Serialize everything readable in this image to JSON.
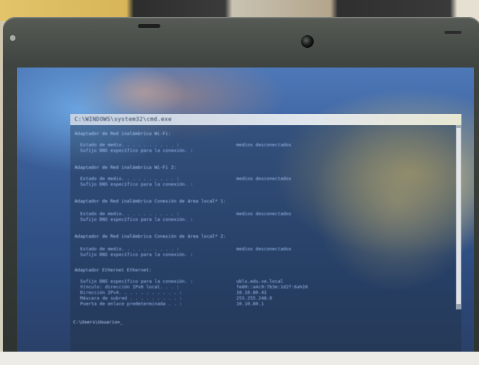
{
  "terminal": {
    "title": "C:\\WINDOWS\\system32\\cmd.exe"
  },
  "output": {
    "sections": [
      {
        "header": "Adaptador de Red inalámbrica Wi-Fi:",
        "lines": [
          {
            "label": "Estado de medio. . . . . . . . . . :",
            "value": "medios desconectados"
          },
          {
            "label": "Sufijo DNS específico para la conexión. :",
            "value": ""
          }
        ]
      },
      {
        "header": "Adaptador de Red inalámbrica Wi-Fi 2:",
        "lines": [
          {
            "label": "Estado de medio. . . . . . . . . . :",
            "value": "medios desconectados"
          },
          {
            "label": "Sufijo DNS específico para la conexión. :",
            "value": ""
          }
        ]
      },
      {
        "header": "Adaptador de Red inalámbrica Conexión de área local* 1:",
        "lines": [
          {
            "label": "Estado de medio. . . . . . . . . . :",
            "value": "medios desconectados"
          },
          {
            "label": "Sufijo DNS específico para la conexión. :",
            "value": ""
          }
        ]
      },
      {
        "header": "Adaptador de Red inalámbrica Conexión de área local* 2:",
        "lines": [
          {
            "label": "Estado de medio. . . . . . . . . . :",
            "value": "medios desconectados"
          },
          {
            "label": "Sufijo DNS específico para la conexión. :",
            "value": ""
          }
        ]
      },
      {
        "header": "Adaptador Ethernet Ethernet:",
        "lines": [
          {
            "label": "Sufijo DNS específico para la conexión. :",
            "value": "ublx.edu.ve.local"
          },
          {
            "label": "Vínculo: dirección IPv6 local. . . :",
            "value": "fe80::a4c9:7b3e:1d2f:6a%10"
          },
          {
            "label": "Dirección IPv4. . . . . . . . . . . :",
            "value": "10.10.80.41"
          },
          {
            "label": "Máscara de subred . . . . . . . . . :",
            "value": "255.255.248.0"
          },
          {
            "label": "Puerta de enlace predeterminada . . :",
            "value": "10.10.80.1"
          }
        ]
      }
    ],
    "prompt": "C:\\Users\\Usuario>_"
  }
}
